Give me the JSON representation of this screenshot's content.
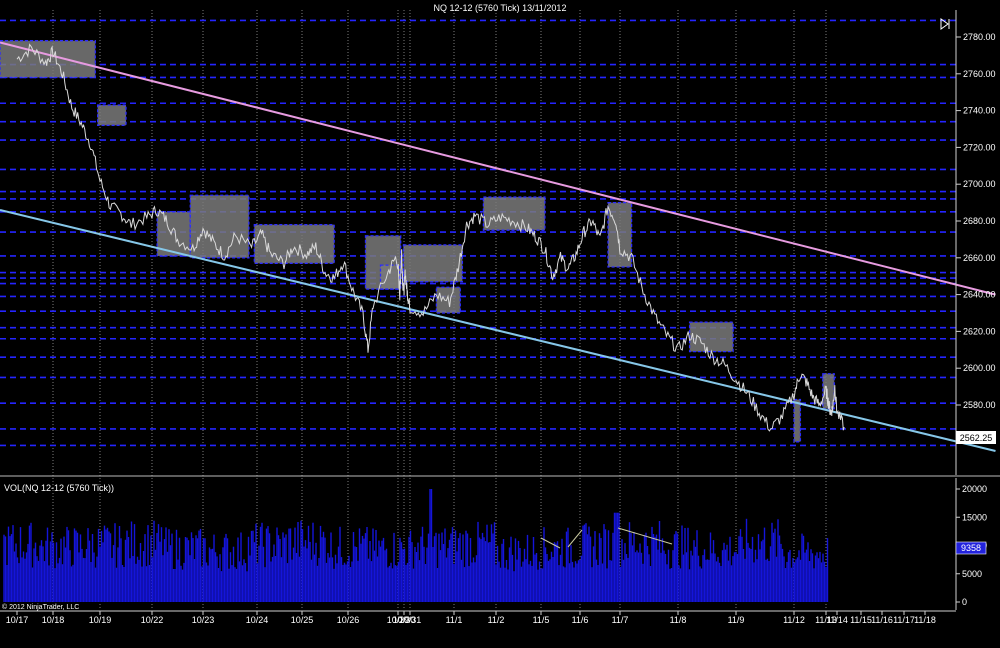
{
  "window": {
    "title": "NQ 12-12 (5760 Tick)  13/11/2012",
    "copyright": "© 2012 NinjaTrader, LLC",
    "last_price_label": "2562.25",
    "volume_label": "VOL(NQ 12-12 (5760 Tick))",
    "last_volume_label": "9358"
  },
  "colors": {
    "background": "#000000",
    "price_line": "#d9d9d9",
    "value_area_fill": "#7a7a7a",
    "value_area_border": "#2b2bff",
    "level_line": "#2424ff",
    "upper_trend": "#e79be0",
    "lower_trend": "#86c7e8",
    "volume_bar": "#1515d9",
    "session_divider": "#7d7d7d"
  },
  "chart_data": [
    {
      "type": "line",
      "title": "NQ 12-12 (5760 Tick)  13/11/2012",
      "xlabel": "",
      "ylabel": "",
      "x": [
        "10/17",
        "10/18",
        "10/19",
        "10/22",
        "10/23",
        "10/24",
        "10/25",
        "10/26",
        "10/29",
        "10/30",
        "10/31",
        "11/1",
        "11/2",
        "11/5",
        "11/6",
        "11/7",
        "11/8",
        "11/9",
        "11/12",
        "11/13"
      ],
      "ylim": [
        2550,
        2790
      ],
      "y_ticks": [
        2580,
        2600,
        2620,
        2640,
        2660,
        2680,
        2700,
        2720,
        2740,
        2760,
        2780
      ],
      "x_tick_labels": [
        "10/17",
        "10/18",
        "10/19",
        "10/22",
        "10/23",
        "10/24",
        "10/25",
        "10/26",
        "10/29",
        "10/30",
        "10/31",
        "11/1",
        "11/2",
        "11/5",
        "11/6",
        "11/7",
        "11/8",
        "11/9",
        "11/12",
        "11/13",
        "11/14",
        "11/15",
        "11/16",
        "11/17",
        "11/18"
      ],
      "series": [
        {
          "values": [
            [
              0,
              2768
            ],
            [
              0.4,
              2774
            ],
            [
              0.8,
              2766
            ],
            [
              1.0,
              2772
            ],
            [
              1.2,
              2760
            ],
            [
              1.4,
              2742
            ],
            [
              1.6,
              2733
            ],
            [
              1.8,
              2722
            ],
            [
              2.0,
              2702
            ],
            [
              2.2,
              2688
            ],
            [
              2.4,
              2684
            ],
            [
              2.6,
              2678
            ],
            [
              2.9,
              2682
            ],
            [
              3.1,
              2686
            ],
            [
              3.3,
              2680
            ],
            [
              3.5,
              2670
            ],
            [
              3.8,
              2665
            ],
            [
              4.0,
              2676
            ],
            [
              4.2,
              2668
            ],
            [
              4.4,
              2661
            ],
            [
              4.6,
              2672
            ],
            [
              4.9,
              2666
            ],
            [
              5.1,
              2673
            ],
            [
              5.3,
              2662
            ],
            [
              5.6,
              2657
            ],
            [
              5.8,
              2666
            ],
            [
              6.1,
              2662
            ],
            [
              6.3,
              2666
            ],
            [
              6.5,
              2652
            ],
            [
              6.7,
              2649
            ],
            [
              6.9,
              2658
            ],
            [
              7.1,
              2642
            ],
            [
              7.3,
              2629
            ],
            [
              7.4,
              2610
            ],
            [
              7.5,
              2634
            ],
            [
              7.8,
              2652
            ],
            [
              7.95,
              2660
            ],
            [
              8.1,
              2650
            ],
            [
              8.3,
              2640
            ],
            [
              8.45,
              2650
            ],
            [
              8.6,
              2664
            ],
            [
              8.8,
              2646
            ],
            [
              9.0,
              2642
            ],
            [
              9.2,
              2652
            ],
            [
              9.5,
              2642
            ],
            [
              9.7,
              2638
            ],
            [
              10.0,
              2633
            ],
            [
              10.3,
              2630
            ],
            [
              10.6,
              2640
            ],
            [
              10.9,
              2636
            ],
            [
              11.1,
              2655
            ],
            [
              11.3,
              2678
            ],
            [
              11.5,
              2683
            ],
            [
              11.8,
              2678
            ],
            [
              12.1,
              2682
            ],
            [
              12.4,
              2680
            ],
            [
              12.7,
              2676
            ],
            [
              12.9,
              2671
            ],
            [
              13.1,
              2664
            ],
            [
              13.3,
              2650
            ],
            [
              13.5,
              2660
            ],
            [
              13.7,
              2654
            ],
            [
              13.9,
              2662
            ],
            [
              14.1,
              2674
            ],
            [
              14.3,
              2680
            ],
            [
              14.5,
              2670
            ],
            [
              14.7,
              2688
            ],
            [
              14.9,
              2680
            ],
            [
              15.0,
              2665
            ],
            [
              15.2,
              2660
            ],
            [
              15.4,
              2642
            ],
            [
              15.6,
              2628
            ],
            [
              15.8,
              2618
            ],
            [
              16.0,
              2610
            ],
            [
              16.2,
              2618
            ],
            [
              16.4,
              2614
            ],
            [
              16.6,
              2606
            ],
            [
              16.8,
              2602
            ],
            [
              17.0,
              2594
            ],
            [
              17.2,
              2586
            ],
            [
              17.4,
              2576
            ],
            [
              17.6,
              2567
            ],
            [
              17.8,
              2574
            ],
            [
              18.0,
              2586
            ],
            [
              18.2,
              2597
            ],
            [
              18.4,
              2592
            ],
            [
              18.6,
              2584
            ],
            [
              18.8,
              2580
            ],
            [
              19.0,
              2588
            ],
            [
              19.2,
              2582
            ],
            [
              19.4,
              2576
            ],
            [
              19.6,
              2578
            ],
            [
              19.8,
              2590
            ],
            [
              20.0,
              2576
            ],
            [
              20.3,
              2568
            ]
          ]
        }
      ],
      "value_areas": [
        {
          "x": [
            0,
            1.9
          ],
          "y": [
            2758,
            2778
          ]
        },
        {
          "x": [
            1.95,
            2.5
          ],
          "y": [
            2732,
            2743
          ]
        },
        {
          "x": [
            3.1,
            3.75
          ],
          "y": [
            2661,
            2685
          ]
        },
        {
          "x": [
            3.75,
            4.85
          ],
          "y": [
            2660,
            2694
          ]
        },
        {
          "x": [
            4.95,
            6.7
          ],
          "y": [
            2657,
            2678
          ]
        },
        {
          "x": [
            7.35,
            8.45
          ],
          "y": [
            2643,
            2672
          ]
        },
        {
          "x": [
            7.65,
            8.3
          ],
          "y": [
            2643,
            2656
          ]
        },
        {
          "x": [
            8.9,
            11.2
          ],
          "y": [
            2647,
            2667
          ]
        },
        {
          "x": [
            10.6,
            11.15
          ],
          "y": [
            2630,
            2644
          ]
        },
        {
          "x": [
            11.7,
            13.1
          ],
          "y": [
            2675,
            2693
          ]
        },
        {
          "x": [
            14.7,
            15.2
          ],
          "y": [
            2655,
            2690
          ]
        },
        {
          "x": [
            16.2,
            16.95
          ],
          "y": [
            2609,
            2625
          ]
        },
        {
          "x": [
            18.0,
            18.2
          ],
          "y": [
            2560,
            2583
          ]
        },
        {
          "x": [
            18.9,
            19.75
          ],
          "y": [
            2578,
            2597
          ]
        }
      ],
      "horizontal_levels": [
        2789,
        2765,
        2758,
        2744,
        2734,
        2724,
        2708,
        2696,
        2692,
        2685,
        2674,
        2661,
        2652,
        2649,
        2646,
        2639,
        2631,
        2622,
        2616,
        2606,
        2595,
        2581,
        2567,
        2558
      ],
      "trend_lines": [
        {
          "from": [
            0,
            2777
          ],
          "to": [
            24.5,
            2640
          ]
        },
        {
          "from": [
            0,
            2686
          ],
          "to": [
            24.5,
            2555
          ]
        }
      ]
    },
    {
      "type": "bar",
      "title": "VOL(NQ 12-12 (5760 Tick))",
      "x": [
        "10/17",
        "10/18",
        "10/19",
        "10/22",
        "10/23",
        "10/24",
        "10/25",
        "10/26",
        "10/29",
        "10/30",
        "10/31",
        "11/1",
        "11/2",
        "11/5",
        "11/6",
        "11/7",
        "11/8",
        "11/9",
        "11/12",
        "11/13"
      ],
      "ylim": [
        0,
        21000
      ],
      "y_ticks": [
        0,
        5000,
        10000,
        15000,
        20000
      ],
      "values": [
        11000,
        10500,
        10800,
        11200,
        10200,
        9800,
        10900,
        11500,
        10400,
        10100,
        10700,
        11000,
        9600,
        10300,
        10800,
        11300,
        10500,
        10000,
        11400,
        9358
      ],
      "last_value": 9358
    }
  ]
}
